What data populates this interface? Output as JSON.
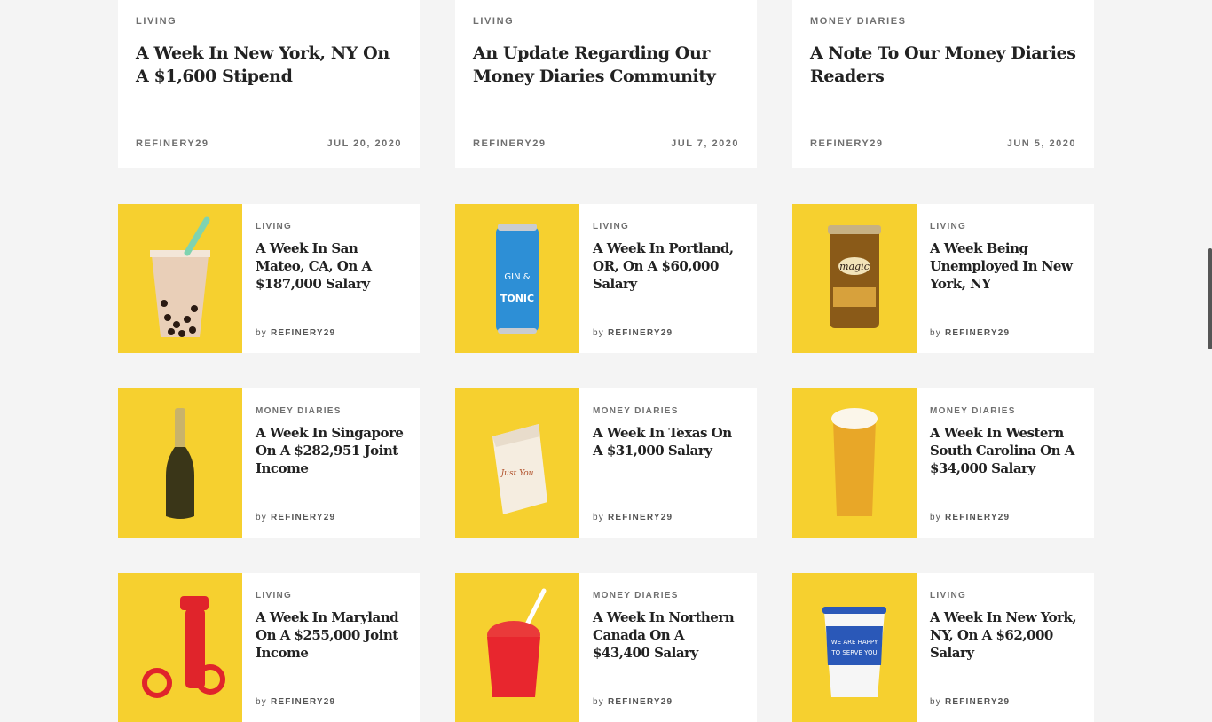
{
  "top_cards": [
    {
      "category": "LIVING",
      "title": "A Week In New York, NY On A $1,600 Stipend",
      "source": "REFINERY29",
      "date": "JUL 20, 2020"
    },
    {
      "category": "LIVING",
      "title": "An Update Regarding Our Money Diaries Community",
      "source": "REFINERY29",
      "date": "JUL 7, 2020"
    },
    {
      "category": "MONEY DIARIES",
      "title": "A Note To Our Money Diaries Readers",
      "source": "REFINERY29",
      "date": "JUN 5, 2020"
    }
  ],
  "cards": [
    {
      "category": "LIVING",
      "title": "A Week In San Mateo, CA, On A $187,000 Salary",
      "by": "by",
      "author": "REFINERY29",
      "thumb_icon": "bubble-tea-icon"
    },
    {
      "category": "LIVING",
      "title": "A Week In Portland, OR, On A $60,000 Salary",
      "by": "by",
      "author": "REFINERY29",
      "thumb_icon": "gin-tonic-can-icon"
    },
    {
      "category": "LIVING",
      "title": "A Week Being Unemployed In New York, NY",
      "by": "by",
      "author": "REFINERY29",
      "thumb_icon": "shaving-powder-can-icon"
    },
    {
      "category": "MONEY DIARIES",
      "title": "A Week In Singapore On A $282,951 Joint Income",
      "by": "by",
      "author": "REFINERY29",
      "thumb_icon": "wine-bottle-icon"
    },
    {
      "category": "MONEY DIARIES",
      "title": "A Week In Texas On A $31,000 Salary",
      "by": "by",
      "author": "REFINERY29",
      "thumb_icon": "paper-bag-icon"
    },
    {
      "category": "MONEY DIARIES",
      "title": "A Week In Western South Carolina On A $34,000 Salary",
      "by": "by",
      "author": "REFINERY29",
      "thumb_icon": "beer-glass-icon"
    },
    {
      "category": "LIVING",
      "title": "A Week In Maryland On A $255,000 Joint Income",
      "by": "by",
      "author": "REFINERY29",
      "thumb_icon": "red-tool-icon"
    },
    {
      "category": "MONEY DIARIES",
      "title": "A Week In Northern Canada On A $43,400 Salary",
      "by": "by",
      "author": "REFINERY29",
      "thumb_icon": "slushie-icon"
    },
    {
      "category": "LIVING",
      "title": "A Week In New York, NY, On A $62,000 Salary",
      "by": "by",
      "author": "REFINERY29",
      "thumb_icon": "coffee-cup-icon"
    }
  ],
  "colors": {
    "thumb_bg": "#f6d02f",
    "title": "#222222",
    "meta": "#6f6f6f"
  }
}
